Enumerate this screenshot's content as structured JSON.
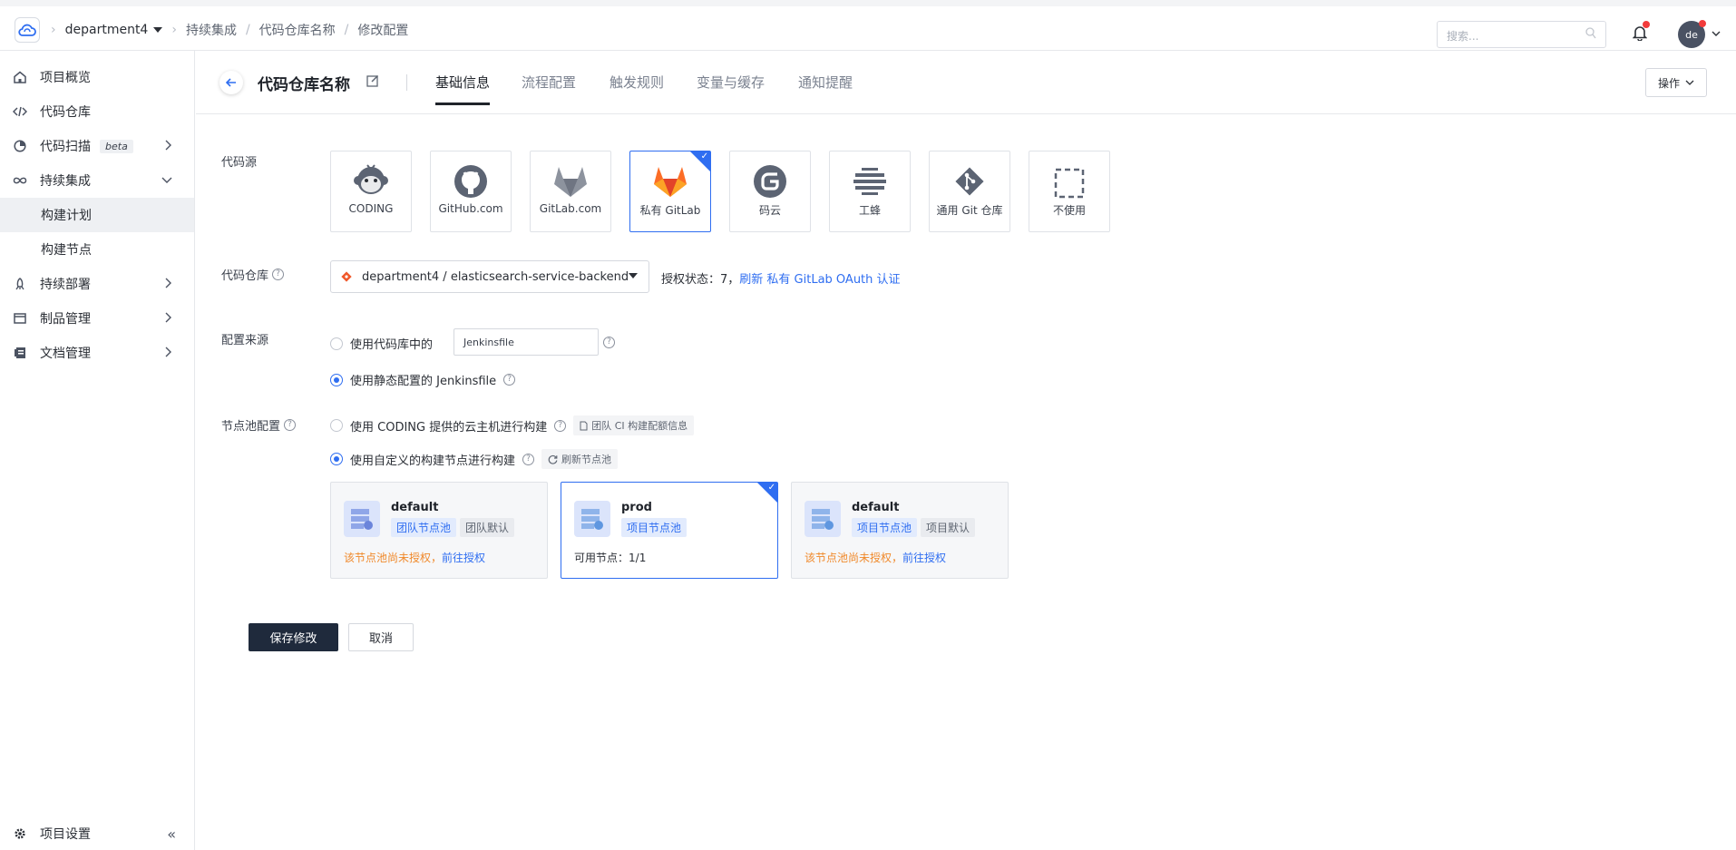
{
  "header": {
    "project": "department4",
    "breadcrumbs": [
      "持续集成",
      "代码仓库名称",
      "修改配置"
    ],
    "search_placeholder": "搜索...",
    "avatar_text": "de"
  },
  "sidebar": {
    "items": [
      {
        "label": "项目概览",
        "icon": "home-icon"
      },
      {
        "label": "代码仓库",
        "icon": "code-icon"
      },
      {
        "label": "代码扫描",
        "icon": "scan-icon",
        "badge": "beta"
      },
      {
        "label": "持续集成",
        "icon": "infinity-icon"
      },
      {
        "label": "构建计划"
      },
      {
        "label": "构建节点"
      },
      {
        "label": "持续部署",
        "icon": "rocket-icon"
      },
      {
        "label": "制品管理",
        "icon": "box-icon"
      },
      {
        "label": "文档管理",
        "icon": "book-icon"
      }
    ],
    "settings_label": "项目设置"
  },
  "page": {
    "title": "代码仓库名称",
    "tabs": [
      "基础信息",
      "流程配置",
      "触发规则",
      "变量与缓存",
      "通知提醒"
    ],
    "active_tab": 0,
    "ops_label": "操作"
  },
  "form": {
    "source_label": "代码源",
    "sources": [
      "CODING",
      "GitHub.com",
      "GitLab.com",
      "私有 GitLab",
      "码云",
      "工蜂",
      "通用 Git 仓库",
      "不使用"
    ],
    "selected_source": 3,
    "repo_label": "代码仓库",
    "repo_value": "department4 / elasticsearch-service-backend",
    "auth_prefix": "授权状态：7，",
    "auth_link": "刷新 私有 GitLab OAuth 认证",
    "config_label": "配置来源",
    "config_option1": "使用代码库中的",
    "jenkinsfile": "Jenkinsfile",
    "config_option2": "使用静态配置的 Jenkinsfile",
    "pool_label": "节点池配置",
    "pool_option1": "使用 CODING 提供的云主机进行构建",
    "pool_option1_chip": "团队 CI 构建配额信息",
    "pool_option2": "使用自定义的构建节点进行构建",
    "pool_option2_chip": "刷新节点池",
    "pools": [
      {
        "name": "default",
        "tag1": "团队节点池",
        "tag2": "团队默认",
        "note": "该节点池尚未授权，",
        "link": "前往授权"
      },
      {
        "name": "prod",
        "tag1": "项目节点池",
        "avail_label": "可用节点：",
        "avail_value": "1/1"
      },
      {
        "name": "default",
        "tag1": "项目节点池",
        "tag2": "项目默认",
        "note": "该节点池尚未授权，",
        "link": "前往授权"
      }
    ],
    "save_label": "保存修改",
    "cancel_label": "取消"
  }
}
